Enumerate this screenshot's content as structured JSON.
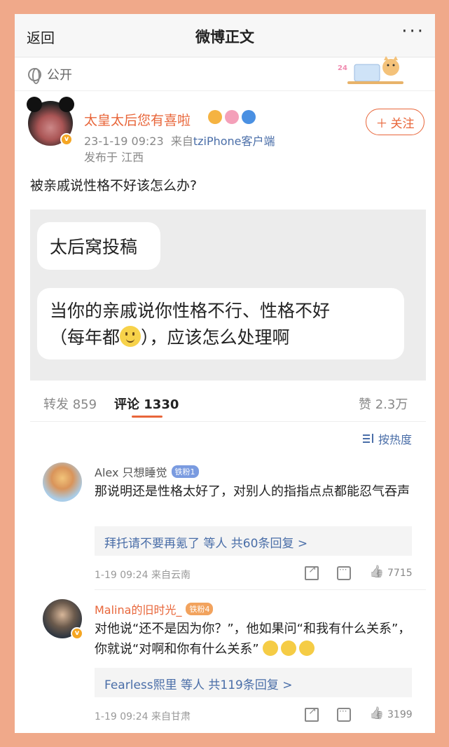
{
  "nav": {
    "back": "返回",
    "title": "微博正文",
    "more": "···"
  },
  "visibility": "公开",
  "post": {
    "author": "太皇太后您有喜啦",
    "time": "23-1-19 09:23",
    "source_prefix": "来自",
    "source": "tziPhone客户端",
    "location": "发布于 江西",
    "follow": "关注",
    "text": "被亲戚说性格不好该怎么办?",
    "image": {
      "bubble1": "太后窝投稿",
      "bubble2_line1": "当你的亲戚说你性格不行、性格不好",
      "bubble2_pre": "（每年都",
      "bubble2_post": "），应该怎么处理啊"
    }
  },
  "tabs": {
    "repost": "转发 859",
    "comments": "评论 1330",
    "likes": "赞 2.3万"
  },
  "sort": "按热度",
  "comments": [
    {
      "name": "Alex 只想睡觉",
      "badge": "铁粉1",
      "text": "那说明还是性格太好了，对别人的指指点点都能忍气吞声",
      "reply": "拜托请不要再氪了 等人  共60条回复 >",
      "meta": "1-19 09:24  来自云南",
      "likes": "7715"
    },
    {
      "name": "Malina的旧时光_",
      "badge": "铁粉4",
      "text": "对他说“还不是因为你？”，他如果问“和我有什么关系”，你就说“对啊和你有什么关系”",
      "reply": "Fearless熙里 等人  共119条回复 >",
      "meta": "1-19 09:24  来自甘肃",
      "likes": "3199"
    }
  ],
  "colors": {
    "accent": "#e8663a",
    "link": "#4a6ea8",
    "border": "#f0a98a"
  }
}
